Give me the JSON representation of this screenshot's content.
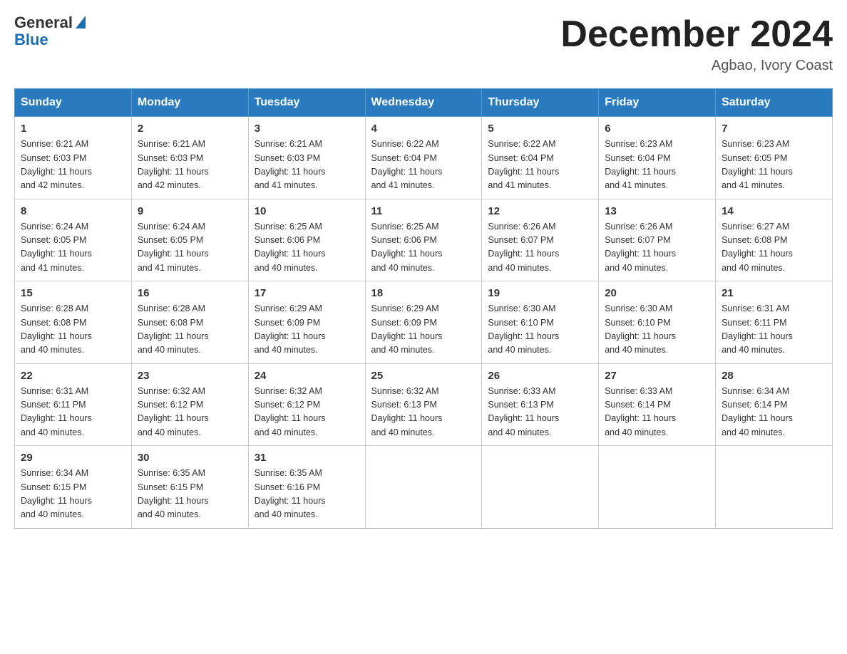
{
  "header": {
    "logo_general": "General",
    "logo_blue": "Blue",
    "title": "December 2024",
    "location": "Agbao, Ivory Coast"
  },
  "weekdays": [
    "Sunday",
    "Monday",
    "Tuesday",
    "Wednesday",
    "Thursday",
    "Friday",
    "Saturday"
  ],
  "weeks": [
    [
      {
        "day": "1",
        "sunrise": "6:21 AM",
        "sunset": "6:03 PM",
        "daylight": "11 hours and 42 minutes."
      },
      {
        "day": "2",
        "sunrise": "6:21 AM",
        "sunset": "6:03 PM",
        "daylight": "11 hours and 42 minutes."
      },
      {
        "day": "3",
        "sunrise": "6:21 AM",
        "sunset": "6:03 PM",
        "daylight": "11 hours and 41 minutes."
      },
      {
        "day": "4",
        "sunrise": "6:22 AM",
        "sunset": "6:04 PM",
        "daylight": "11 hours and 41 minutes."
      },
      {
        "day": "5",
        "sunrise": "6:22 AM",
        "sunset": "6:04 PM",
        "daylight": "11 hours and 41 minutes."
      },
      {
        "day": "6",
        "sunrise": "6:23 AM",
        "sunset": "6:04 PM",
        "daylight": "11 hours and 41 minutes."
      },
      {
        "day": "7",
        "sunrise": "6:23 AM",
        "sunset": "6:05 PM",
        "daylight": "11 hours and 41 minutes."
      }
    ],
    [
      {
        "day": "8",
        "sunrise": "6:24 AM",
        "sunset": "6:05 PM",
        "daylight": "11 hours and 41 minutes."
      },
      {
        "day": "9",
        "sunrise": "6:24 AM",
        "sunset": "6:05 PM",
        "daylight": "11 hours and 41 minutes."
      },
      {
        "day": "10",
        "sunrise": "6:25 AM",
        "sunset": "6:06 PM",
        "daylight": "11 hours and 40 minutes."
      },
      {
        "day": "11",
        "sunrise": "6:25 AM",
        "sunset": "6:06 PM",
        "daylight": "11 hours and 40 minutes."
      },
      {
        "day": "12",
        "sunrise": "6:26 AM",
        "sunset": "6:07 PM",
        "daylight": "11 hours and 40 minutes."
      },
      {
        "day": "13",
        "sunrise": "6:26 AM",
        "sunset": "6:07 PM",
        "daylight": "11 hours and 40 minutes."
      },
      {
        "day": "14",
        "sunrise": "6:27 AM",
        "sunset": "6:08 PM",
        "daylight": "11 hours and 40 minutes."
      }
    ],
    [
      {
        "day": "15",
        "sunrise": "6:28 AM",
        "sunset": "6:08 PM",
        "daylight": "11 hours and 40 minutes."
      },
      {
        "day": "16",
        "sunrise": "6:28 AM",
        "sunset": "6:08 PM",
        "daylight": "11 hours and 40 minutes."
      },
      {
        "day": "17",
        "sunrise": "6:29 AM",
        "sunset": "6:09 PM",
        "daylight": "11 hours and 40 minutes."
      },
      {
        "day": "18",
        "sunrise": "6:29 AM",
        "sunset": "6:09 PM",
        "daylight": "11 hours and 40 minutes."
      },
      {
        "day": "19",
        "sunrise": "6:30 AM",
        "sunset": "6:10 PM",
        "daylight": "11 hours and 40 minutes."
      },
      {
        "day": "20",
        "sunrise": "6:30 AM",
        "sunset": "6:10 PM",
        "daylight": "11 hours and 40 minutes."
      },
      {
        "day": "21",
        "sunrise": "6:31 AM",
        "sunset": "6:11 PM",
        "daylight": "11 hours and 40 minutes."
      }
    ],
    [
      {
        "day": "22",
        "sunrise": "6:31 AM",
        "sunset": "6:11 PM",
        "daylight": "11 hours and 40 minutes."
      },
      {
        "day": "23",
        "sunrise": "6:32 AM",
        "sunset": "6:12 PM",
        "daylight": "11 hours and 40 minutes."
      },
      {
        "day": "24",
        "sunrise": "6:32 AM",
        "sunset": "6:12 PM",
        "daylight": "11 hours and 40 minutes."
      },
      {
        "day": "25",
        "sunrise": "6:32 AM",
        "sunset": "6:13 PM",
        "daylight": "11 hours and 40 minutes."
      },
      {
        "day": "26",
        "sunrise": "6:33 AM",
        "sunset": "6:13 PM",
        "daylight": "11 hours and 40 minutes."
      },
      {
        "day": "27",
        "sunrise": "6:33 AM",
        "sunset": "6:14 PM",
        "daylight": "11 hours and 40 minutes."
      },
      {
        "day": "28",
        "sunrise": "6:34 AM",
        "sunset": "6:14 PM",
        "daylight": "11 hours and 40 minutes."
      }
    ],
    [
      {
        "day": "29",
        "sunrise": "6:34 AM",
        "sunset": "6:15 PM",
        "daylight": "11 hours and 40 minutes."
      },
      {
        "day": "30",
        "sunrise": "6:35 AM",
        "sunset": "6:15 PM",
        "daylight": "11 hours and 40 minutes."
      },
      {
        "day": "31",
        "sunrise": "6:35 AM",
        "sunset": "6:16 PM",
        "daylight": "11 hours and 40 minutes."
      },
      null,
      null,
      null,
      null
    ]
  ],
  "labels": {
    "sunrise": "Sunrise:",
    "sunset": "Sunset:",
    "daylight": "Daylight:"
  }
}
